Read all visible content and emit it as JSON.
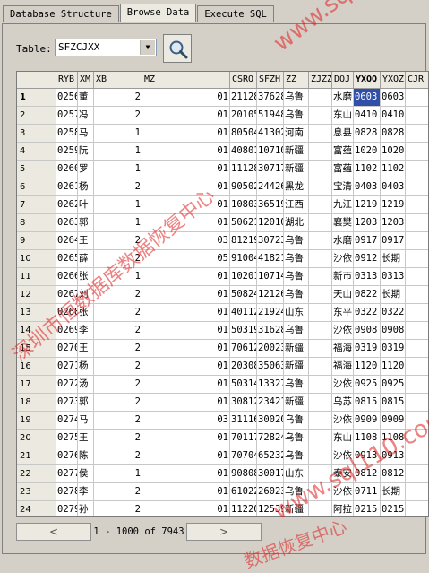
{
  "tabs": [
    {
      "label": "Database Structure"
    },
    {
      "label": "Browse Data"
    },
    {
      "label": "Execute SQL"
    }
  ],
  "table_selector": {
    "label": "Table:",
    "value": "SFZCJXX"
  },
  "columns": [
    "",
    "RYB",
    "XM",
    "XB",
    "MZ",
    "CSRQ",
    "SFZH",
    "ZZ",
    "ZJZZ",
    "DQJ",
    "YXQQ",
    "YXQZ",
    "CJR"
  ],
  "rows": [
    [
      "1",
      "0256",
      "董",
      "2",
      "01",
      "21128",
      "37628",
      "乌鲁",
      "",
      "水磨",
      "0603",
      "0603",
      ""
    ],
    [
      "2",
      "0257",
      "冯",
      "2",
      "01",
      "20105",
      "51948",
      "乌鲁",
      "",
      "东山",
      "0410",
      "0410",
      ""
    ],
    [
      "3",
      "0258",
      "马",
      "1",
      "01",
      "80504",
      "41302",
      "河南",
      "",
      "息县",
      "0828",
      "0828",
      ""
    ],
    [
      "4",
      "0259",
      "阮",
      "1",
      "01",
      "40801",
      "10710",
      "新疆",
      "",
      "富蕴",
      "1020",
      "1020",
      ""
    ],
    [
      "5",
      "0260",
      "罗",
      "1",
      "01",
      "11128",
      "30717",
      "新疆",
      "",
      "富蕴",
      "1102",
      "1102",
      ""
    ],
    [
      "6",
      "0261",
      "杨",
      "2",
      "01",
      "90502",
      "24426",
      "黑龙",
      "",
      "宝清",
      "0403",
      "0403",
      ""
    ],
    [
      "7",
      "0262",
      "叶",
      "1",
      "01",
      "10803",
      "36519",
      "江西",
      "",
      "九江",
      "1219",
      "1219",
      ""
    ],
    [
      "8",
      "0263",
      "郭",
      "1",
      "01",
      "50621",
      "12010",
      "湖北",
      "",
      "襄樊",
      "1203",
      "1203",
      ""
    ],
    [
      "9",
      "0264",
      "王",
      "2",
      "03",
      "81219",
      "30723",
      "乌鲁",
      "",
      "水磨",
      "0917",
      "0917",
      ""
    ],
    [
      "10",
      "0265",
      "薛",
      "2",
      "05",
      "91004",
      "41821",
      "乌鲁",
      "",
      "沙依",
      "0912",
      "长期",
      ""
    ],
    [
      "11",
      "0266",
      "张",
      "1",
      "01",
      "10201",
      "10714",
      "乌鲁",
      "",
      "新市",
      "0313",
      "0313",
      ""
    ],
    [
      "12",
      "0267",
      "刘",
      "2",
      "01",
      "50824",
      "12126",
      "乌鲁",
      "",
      "天山",
      "0822",
      "长期",
      ""
    ],
    [
      "13",
      "0268",
      "张",
      "2",
      "01",
      "40112",
      "21924",
      "山东",
      "",
      "东平",
      "0322",
      "0322",
      ""
    ],
    [
      "14",
      "0269",
      "李",
      "2",
      "01",
      "50319",
      "31628",
      "乌鲁",
      "",
      "沙依",
      "0908",
      "0908",
      ""
    ],
    [
      "15",
      "0270",
      "王",
      "2",
      "01",
      "70612",
      "20023",
      "新疆",
      "",
      "福海",
      "0319",
      "0319",
      ""
    ],
    [
      "16",
      "0271",
      "杨",
      "2",
      "01",
      "20308",
      "35063",
      "新疆",
      "",
      "福海",
      "1120",
      "1120",
      ""
    ],
    [
      "17",
      "0272",
      "汤",
      "2",
      "01",
      "50314",
      "13327",
      "乌鲁",
      "",
      "沙依",
      "0925",
      "0925",
      ""
    ],
    [
      "18",
      "0273",
      "郭",
      "2",
      "01",
      "30812",
      "23421",
      "新疆",
      "",
      "乌苏",
      "0815",
      "0815",
      ""
    ],
    [
      "19",
      "0274",
      "马",
      "2",
      "03",
      "31116",
      "30020",
      "乌鲁",
      "",
      "沙依",
      "0909",
      "0909",
      ""
    ],
    [
      "20",
      "0275",
      "王",
      "2",
      "01",
      "70117",
      "72824",
      "乌鲁",
      "",
      "东山",
      "1108",
      "1108",
      ""
    ],
    [
      "21",
      "0276",
      "陈",
      "2",
      "01",
      "70704",
      "65232",
      "乌鲁",
      "",
      "沙依",
      "0913",
      "0913",
      ""
    ],
    [
      "22",
      "0277",
      "侯",
      "1",
      "01",
      "90808",
      "30017",
      "山东",
      "",
      "泰安",
      "0812",
      "0812",
      ""
    ],
    [
      "23",
      "0278",
      "李",
      "2",
      "01",
      "61022",
      "26023",
      "乌鲁",
      "",
      "沙依",
      "0711",
      "长期",
      ""
    ],
    [
      "24",
      "0279",
      "孙",
      "2",
      "01",
      "11220",
      "12539",
      "新疆",
      "",
      "阿拉",
      "0215",
      "0215",
      ""
    ]
  ],
  "selected_row": 0,
  "selected_col": 10,
  "pager": {
    "prev": "<",
    "next": ">",
    "range_text": "1 - 1000 of 7943"
  },
  "watermarks": {
    "url1": "www.sql110.com",
    "url2": "www.sql110.com",
    "cn1": "深圳市恒数据库数据恢复中心",
    "cn2": "数据恢复中心"
  },
  "colors": {
    "selection": "#2f4fa8",
    "watermark": "#e02020"
  }
}
